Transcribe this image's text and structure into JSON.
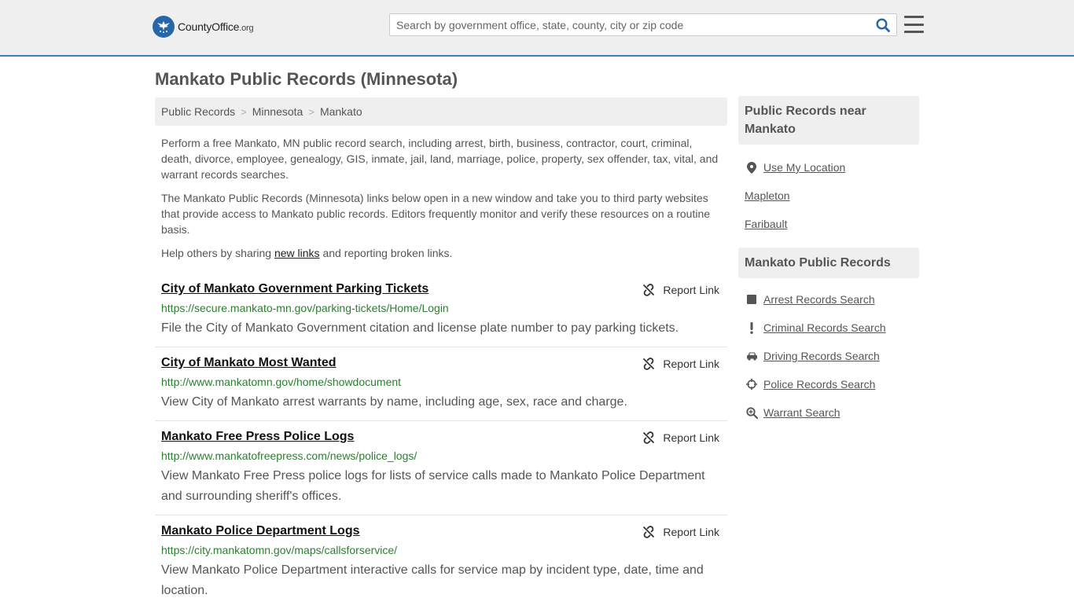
{
  "header": {
    "logo_main": "CountyOffice",
    "logo_tld": ".org",
    "search_placeholder": "Search by government office, state, county, city or zip code"
  },
  "page_title": "Mankato Public Records (Minnesota)",
  "breadcrumb": [
    "Public Records",
    "Minnesota",
    "Mankato"
  ],
  "intro": {
    "p1": "Perform a free Mankato, MN public record search, including arrest, birth, business, contractor, court, criminal, death, divorce, employee, genealogy, GIS, inmate, jail, land, marriage, police, property, sex offender, tax, vital, and warrant records searches.",
    "p2": "The Mankato Public Records (Minnesota) links below open in a new window and take you to third party websites that provide access to Mankato public records. Editors frequently monitor and verify these resources on a routine basis.",
    "p3_before": "Help others by sharing ",
    "p3_link": "new links",
    "p3_after": " and reporting broken links."
  },
  "report_label": "Report Link",
  "records": [
    {
      "title": "City of Mankato Government Parking Tickets",
      "url": "https://secure.mankato-mn.gov/parking-tickets/Home/Login",
      "desc": "File the City of Mankato Government citation and license plate number to pay parking tickets."
    },
    {
      "title": "City of Mankato Most Wanted",
      "url": "http://www.mankatomn.gov/home/showdocument",
      "desc": "View City of Mankato arrest warrants by name, including age, sex, race and charge."
    },
    {
      "title": "Mankato Free Press Police Logs",
      "url": "http://www.mankatofreepress.com/news/police_logs/",
      "desc": "View Mankato Free Press police logs for lists of service calls made to Mankato Police Department and surrounding sheriff's offices."
    },
    {
      "title": "Mankato Police Department Logs",
      "url": "https://city.mankatomn.gov/maps/callsforservice/",
      "desc": "View Mankato Police Department interactive calls for service map by incident type, date, time and location."
    }
  ],
  "sidebar": {
    "near_title": "Public Records near Mankato",
    "use_location": "Use My Location",
    "nearby": [
      "Mapleton",
      "Faribault"
    ],
    "records_title": "Mankato Public Records",
    "links": [
      {
        "label": "Arrest Records Search",
        "icon": "square-icon"
      },
      {
        "label": "Criminal Records Search",
        "icon": "exclamation-icon"
      },
      {
        "label": "Driving Records Search",
        "icon": "car-icon"
      },
      {
        "label": "Police Records Search",
        "icon": "crosshairs-icon"
      },
      {
        "label": "Warrant Search",
        "icon": "search-plus-icon"
      }
    ]
  },
  "colors": {
    "accent": "#3a7fc1",
    "url_green": "#2e7d32",
    "panel_gray": "#efefef"
  }
}
